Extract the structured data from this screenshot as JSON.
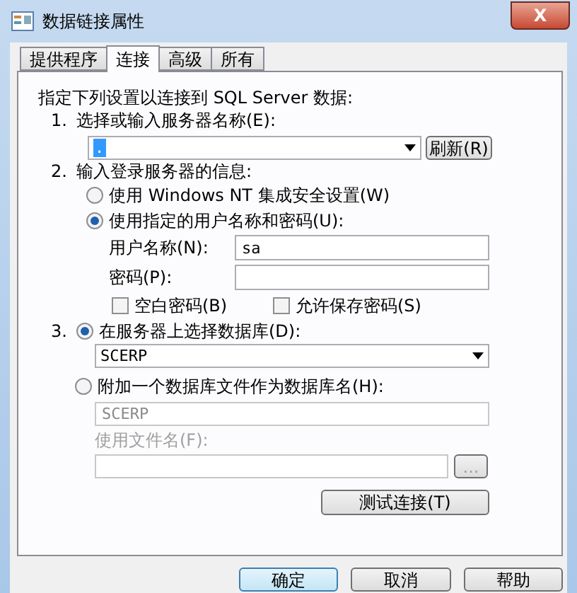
{
  "window": {
    "title": "数据链接属性",
    "close": "X"
  },
  "tabs": [
    {
      "label": "提供程序",
      "selected": false
    },
    {
      "label": "连接",
      "selected": true
    },
    {
      "label": "高级",
      "selected": false
    },
    {
      "label": "所有",
      "selected": false
    }
  ],
  "intro": "指定下列设置以连接到 SQL Server 数据:",
  "step1": {
    "number": "1.",
    "label": "选择或输入服务器名称(E):",
    "server": {
      "value": ".",
      "text_selected": true
    },
    "refresh_button": "刷新(R)"
  },
  "step2": {
    "number": "2.",
    "label": "输入登录服务器的信息:",
    "auth_options": [
      {
        "label": "使用 Windows NT 集成安全设置(W)",
        "selected": false
      },
      {
        "label": "使用指定的用户名称和密码(U):",
        "selected": true
      }
    ],
    "username": {
      "label": "用户名称(N):",
      "value": "sa"
    },
    "password": {
      "label": "密码(P):"
    },
    "checkboxes": [
      {
        "label": "空白密码(B)",
        "checked": false
      },
      {
        "label": "允许保存密码(S)",
        "checked": false
      }
    ]
  },
  "step3": {
    "number": "3.",
    "database_option": {
      "label": "在服务器上选择数据库(D):",
      "selected": true
    },
    "database": "SCERP",
    "attach_option": {
      "label": "附加一个数据库文件作为数据库名(H):",
      "selected": false
    },
    "attach": {
      "disabled": true,
      "name": "SCERP",
      "filename_label": "使用文件名(F):",
      "browse_button": "..."
    },
    "test_button": "测试连接(T)"
  },
  "buttons": [
    {
      "label": "确定",
      "default": true
    },
    {
      "label": "取消",
      "default": false
    },
    {
      "label": "帮助",
      "default": false
    }
  ]
}
